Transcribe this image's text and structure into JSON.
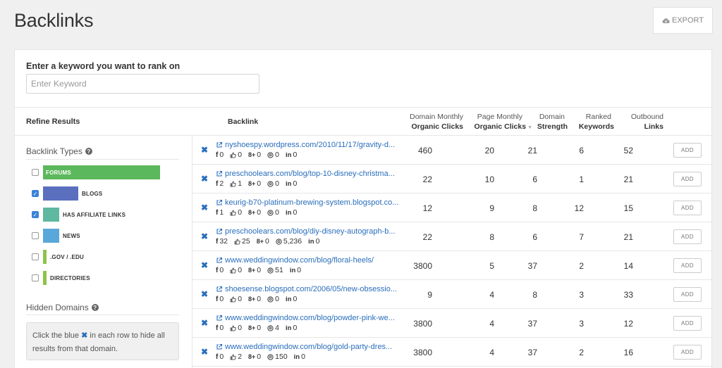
{
  "header": {
    "title": "Backlinks",
    "export_label": "EXPORT"
  },
  "keyword": {
    "label": "Enter a keyword you want to rank on",
    "placeholder": "Enter Keyword",
    "value": ""
  },
  "refine": {
    "title": "Refine Results",
    "backlink_types_label": "Backlink Types",
    "types": [
      {
        "label": "FORUMS",
        "checked": false,
        "color": "#5cb85c",
        "fill": 1.0,
        "label_inside": true
      },
      {
        "label": "BLOGS",
        "checked": true,
        "color": "#5b6fbf",
        "fill": 0.3,
        "label_inside": false
      },
      {
        "label": "HAS AFFILIATE LINKS",
        "checked": true,
        "color": "#5fb8a0",
        "fill": 0.14,
        "label_inside": false
      },
      {
        "label": "NEWS",
        "checked": false,
        "color": "#5aa7d9",
        "fill": 0.14,
        "label_inside": false
      },
      {
        "label": ".GOV / .EDU",
        "checked": false,
        "color": "#8dc449",
        "fill": 0.03,
        "label_inside": false
      },
      {
        "label": "DIRECTORIES",
        "checked": false,
        "color": "#8dc449",
        "fill": 0.03,
        "label_inside": false
      }
    ],
    "hidden_domains_label": "Hidden Domains",
    "note_before": "Click the blue",
    "note_x": "✖",
    "note_after": "in each row to hide all results from that domain."
  },
  "columns": {
    "backlink": "Backlink",
    "domain_clicks_top": "Domain Monthly",
    "domain_clicks_bottom": "Organic Clicks",
    "page_clicks_top": "Page Monthly",
    "page_clicks_bottom": "Organic Clicks",
    "domain_strength_top": "Domain",
    "domain_strength_bottom": "Strength",
    "ranked_top": "Ranked",
    "ranked_bottom": "Keywords",
    "outbound_top": "Outbound",
    "outbound_bottom": "Links"
  },
  "add_label": "ADD",
  "rows": [
    {
      "url": "nyshoespy.wordpress.com/2010/11/17/gravity-d...",
      "fb": "0",
      "likes": "0",
      "gplus": "0",
      "pin": "0",
      "li": "0",
      "domain_clicks": "460",
      "page_clicks": "20",
      "strength": "21",
      "ranked": "6",
      "outbound": "52"
    },
    {
      "url": "preschoolears.com/blog/top-10-disney-christma...",
      "fb": "2",
      "likes": "1",
      "gplus": "0",
      "pin": "0",
      "li": "0",
      "domain_clicks": "22",
      "page_clicks": "10",
      "strength": "6",
      "ranked": "1",
      "outbound": "21"
    },
    {
      "url": "keurig-b70-platinum-brewing-system.blogspot.co...",
      "fb": "1",
      "likes": "0",
      "gplus": "0",
      "pin": "0",
      "li": "0",
      "domain_clicks": "12",
      "page_clicks": "9",
      "strength": "8",
      "ranked": "12",
      "outbound": "15"
    },
    {
      "url": "preschoolears.com/blog/diy-disney-autograph-b...",
      "fb": "32",
      "likes": "25",
      "gplus": "0",
      "pin": "5,236",
      "li": "0",
      "domain_clicks": "22",
      "page_clicks": "8",
      "strength": "6",
      "ranked": "7",
      "outbound": "21"
    },
    {
      "url": "www.weddingwindow.com/blog/floral-heels/",
      "fb": "0",
      "likes": "0",
      "gplus": "0",
      "pin": "51",
      "li": "0",
      "domain_clicks": "3800",
      "page_clicks": "5",
      "strength": "37",
      "ranked": "2",
      "outbound": "14"
    },
    {
      "url": "shoesense.blogspot.com/2006/05/new-obsessio...",
      "fb": "0",
      "likes": "0",
      "gplus": "0",
      "pin": "0",
      "li": "0",
      "domain_clicks": "9",
      "page_clicks": "4",
      "strength": "8",
      "ranked": "3",
      "outbound": "33"
    },
    {
      "url": "www.weddingwindow.com/blog/powder-pink-we...",
      "fb": "0",
      "likes": "0",
      "gplus": "0",
      "pin": "4",
      "li": "0",
      "domain_clicks": "3800",
      "page_clicks": "4",
      "strength": "37",
      "ranked": "3",
      "outbound": "12"
    },
    {
      "url": "www.weddingwindow.com/blog/gold-party-dres...",
      "fb": "0",
      "likes": "2",
      "gplus": "0",
      "pin": "150",
      "li": "0",
      "domain_clicks": "3800",
      "page_clicks": "4",
      "strength": "37",
      "ranked": "2",
      "outbound": "16"
    }
  ]
}
